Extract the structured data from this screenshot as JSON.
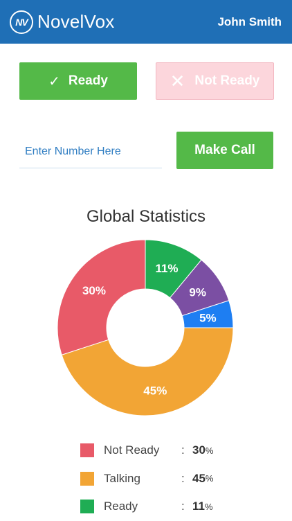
{
  "header": {
    "logo_mark": "NV",
    "brand_name": "NovelVox",
    "user_name": "John Smith",
    "color": "#1f6fb6"
  },
  "status_buttons": {
    "ready_label": "Ready",
    "ready_icon": "check-icon",
    "not_ready_label": "Not Ready",
    "not_ready_icon": "close-icon"
  },
  "dialer": {
    "input_placeholder": "Enter Number Here",
    "input_value": "",
    "call_label": "Make Call"
  },
  "chart_data": {
    "type": "pie",
    "title": "Global Statistics",
    "donut": true,
    "slices": [
      {
        "label": "Not Ready",
        "value": 30,
        "display": "30%",
        "color": "#e85a68"
      },
      {
        "label": "Talking",
        "value": 45,
        "display": "45%",
        "color": "#f2a535"
      },
      {
        "label": "",
        "value": 5,
        "display": "5%",
        "color": "#1e7ef2"
      },
      {
        "label": "",
        "value": 9,
        "display": "9%",
        "color": "#7b4fa3"
      },
      {
        "label": "Ready",
        "value": 11,
        "display": "11%",
        "color": "#1fad54"
      }
    ]
  },
  "legend": [
    {
      "label": "Not Ready",
      "colon": ":",
      "value": "30",
      "unit": "%",
      "color": "#e85a68"
    },
    {
      "label": "Talking",
      "colon": ":",
      "value": "45",
      "unit": "%",
      "color": "#f2a535"
    },
    {
      "label": "Ready",
      "colon": ":",
      "value": "11",
      "unit": "%",
      "color": "#1fad54"
    }
  ]
}
